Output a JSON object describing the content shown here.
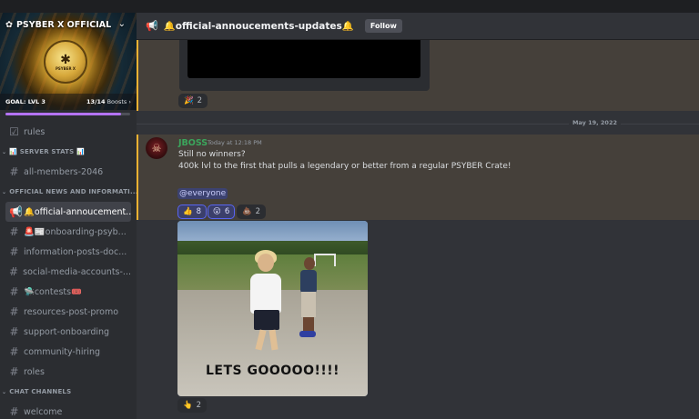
{
  "server": {
    "name": "PSYBER X OFFICIAL",
    "emblem_text": "PSYBER X",
    "goal_label": "GOAL: LVL 3",
    "boosts_count": "13/14",
    "boosts_label": "Boosts",
    "boost_progress": 0.93
  },
  "sidebar": {
    "items": [
      {
        "kind": "channel",
        "icon": "checkbox-icon",
        "label": "rules"
      },
      {
        "kind": "category",
        "label": "📊 SERVER STATS 📊"
      },
      {
        "kind": "channel",
        "icon": "hash-icon",
        "label": "all-members-2046"
      },
      {
        "kind": "category",
        "label": "OFFICIAL NEWS AND INFORMATI..."
      },
      {
        "kind": "channel",
        "icon": "megaphone-icon",
        "label": "🔔official-annoucement...",
        "active": true
      },
      {
        "kind": "channel",
        "icon": "hash-icon",
        "label": "🚨📰onboarding-psyb..."
      },
      {
        "kind": "channel",
        "icon": "hash-icon",
        "label": "information-posts-doc..."
      },
      {
        "kind": "channel",
        "icon": "hash-icon",
        "label": "social-media-accounts-..."
      },
      {
        "kind": "channel",
        "icon": "hash-icon",
        "label": "🛸contests🎟️"
      },
      {
        "kind": "channel",
        "icon": "hash-icon",
        "label": "resources-post-promo"
      },
      {
        "kind": "channel",
        "icon": "hash-icon",
        "label": "support-onboarding"
      },
      {
        "kind": "channel",
        "icon": "hash-icon",
        "label": "community-hiring"
      },
      {
        "kind": "channel",
        "icon": "hash-icon",
        "label": "roles"
      },
      {
        "kind": "category",
        "label": "CHAT CHANNELS"
      },
      {
        "kind": "channel",
        "icon": "hash-icon",
        "label": "welcome"
      }
    ]
  },
  "header": {
    "channel_name": "🔔official-annoucements-updates🔔",
    "follow_label": "Follow"
  },
  "messages": {
    "prev_reaction": {
      "emoji": "🎉",
      "count": "2"
    },
    "date_divider": "May 19, 2022",
    "post": {
      "author": "JBOSS",
      "timestamp": "Today at 12:18 PM",
      "line1": "Still no winners?",
      "line2": "400k lvl to the first that pulls a legendary or better from a regular PSYBER Crate!",
      "mention": "@everyone",
      "reactions": [
        {
          "emoji": "👍",
          "count": "8"
        },
        {
          "emoji": "😮",
          "count": "6"
        },
        {
          "emoji": "💩",
          "count": "2"
        }
      ]
    },
    "gif": {
      "caption": "LETS GOOOOO!!!!",
      "reaction": {
        "emoji": "👆",
        "count": "2"
      }
    }
  },
  "colors": {
    "accent": "#5865f2",
    "highlight_bar": "#f0b232",
    "author": "#3ba55c",
    "boost": "#b473f5"
  }
}
